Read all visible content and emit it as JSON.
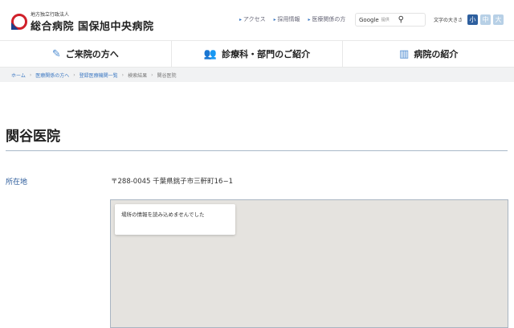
{
  "header": {
    "logo_sub": "地方独立行政法人",
    "logo_main": "総合病院 国保旭中央病院",
    "links": [
      "アクセス",
      "採用情報",
      "医療関係の方"
    ],
    "search": {
      "brand": "Google",
      "sub": "提供",
      "icon": "search-icon"
    },
    "font_size": {
      "label": "文字の大きさ",
      "options": [
        "小",
        "中",
        "大"
      ],
      "selected": "小"
    }
  },
  "nav": [
    {
      "label": "ご来院の方へ",
      "icon": "memo-icon"
    },
    {
      "label": "診療科・部門のご紹介",
      "icon": "people-icon"
    },
    {
      "label": "病院の紹介",
      "icon": "building-icon"
    }
  ],
  "breadcrumb": [
    "ホーム",
    "医療関係の方へ",
    "登録医療機関一覧",
    "検索結果",
    "関谷医院"
  ],
  "page": {
    "title": "関谷医院",
    "location_label": "所在地",
    "address": "〒288-0045 千葉県銚子市三軒町16−1",
    "map_error": "場所の情報を読み込めませんでした"
  },
  "colors": {
    "accent": "#2e5f9e",
    "link": "#3a77c2"
  }
}
